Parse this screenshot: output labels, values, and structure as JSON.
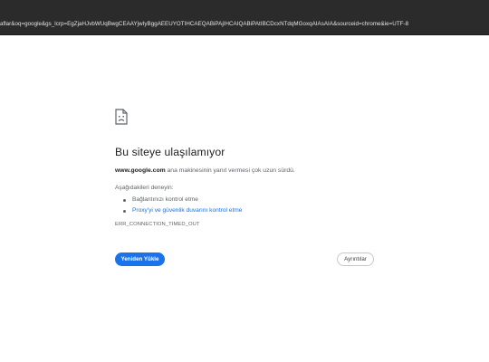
{
  "address_bar": {
    "url": "aflar&oq=google&gs_lcrp=EgZjaHJvbWUqBwgCEAAYjwIyBggAEEUYOTIHCAEQABiPAjIHCAIQABiPAtIBCDcxNTdqMGoxqAIAsAIA&sourceid=chrome&ie=UTF-8"
  },
  "error": {
    "title": "Bu siteye ulaşılamıyor",
    "host": "www.google.com",
    "description_rest": " ana makinesinin yanıt vermesi çok uzun sürdü.",
    "try_label": "Aşağıdakileri deneyin:",
    "suggestions": [
      {
        "text": "Bağlantınızı kontrol etme"
      },
      {
        "text": "Proxy'yi ve güvenlik duvarını kontrol etme"
      }
    ],
    "code": "ERR_CONNECTION_TIMED_OUT"
  },
  "buttons": {
    "reload_label": "Yeniden Yükle",
    "details_label": "Ayrıntılar"
  },
  "colors": {
    "accent": "#1a73e8",
    "dark_chrome": "#2b2b2b"
  },
  "icons": {
    "error": "sad-page-icon"
  }
}
